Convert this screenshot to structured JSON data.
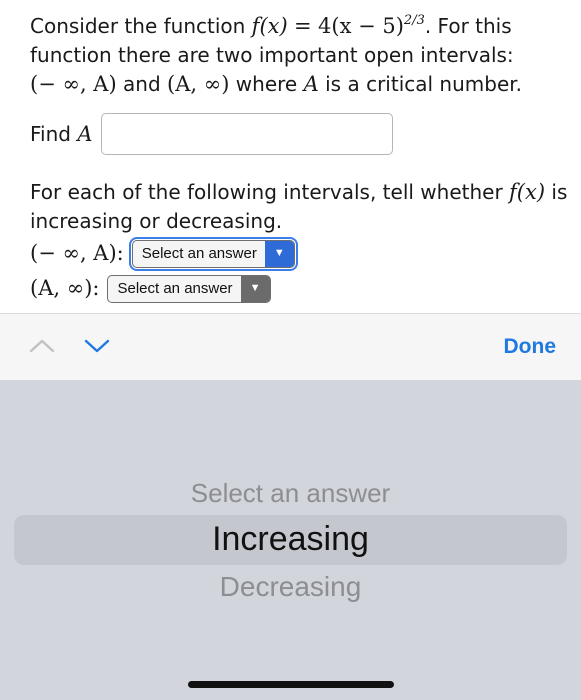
{
  "problem": {
    "intro_prefix": "Consider the function",
    "func_lhs": "f(x)",
    "func_rhs": "4(x − 5)",
    "exponent": "2/3",
    "intro_suffix": ". For this",
    "line2": "function there are two important open intervals:",
    "interval1": "(− ∞, A)",
    "and": "and",
    "interval2": "(A, ∞)",
    "where": "where",
    "var_a": "A",
    "tail": "is a critical number.",
    "find_label": "Find",
    "find_var": "A",
    "find_value": ""
  },
  "question2": {
    "prefix": "For each of the following intervals, tell whether",
    "func": "f(x)",
    "is": "is",
    "line2": "increasing or decreasing.",
    "rows": [
      {
        "interval": "(− ∞, A):",
        "selected": "Select an answer"
      },
      {
        "interval": "(A, ∞):",
        "selected": "Select an answer"
      }
    ]
  },
  "toolbar": {
    "prev_icon": "chevron-up-icon",
    "next_icon": "chevron-down-icon",
    "done_label": "Done"
  },
  "picker": {
    "options": [
      "Select an answer",
      "Increasing",
      "Decreasing"
    ],
    "selected": "Increasing"
  },
  "colors": {
    "accent": "#1f7ae0",
    "picker_bg": "#d3d5dc",
    "toolbar_bg": "#f6f6f7"
  }
}
